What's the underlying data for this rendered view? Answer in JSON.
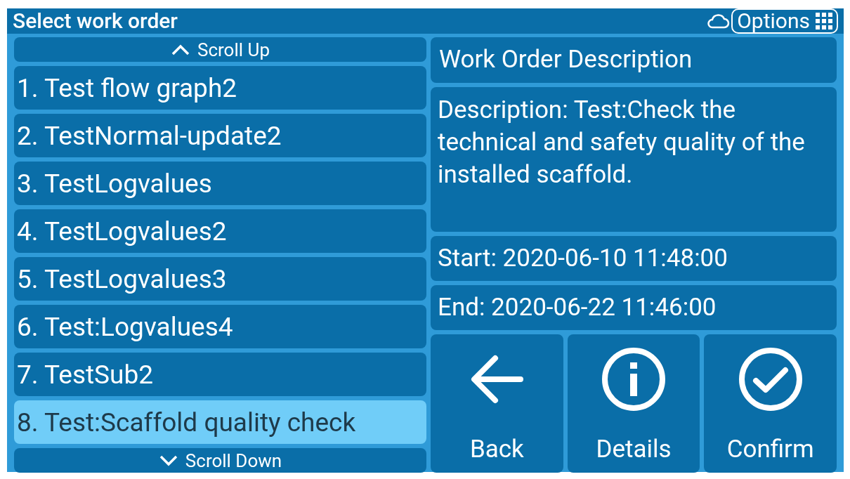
{
  "window": {
    "title": "Select work order",
    "options_button": "Options"
  },
  "list": {
    "scroll_up": "Scroll Up",
    "scroll_down": "Scroll Down",
    "items": [
      {
        "label": "1. Test flow graph2",
        "selected": false
      },
      {
        "label": "2. TestNormal-update2",
        "selected": false
      },
      {
        "label": "3. TestLogvalues",
        "selected": false
      },
      {
        "label": "4. TestLogvalues2",
        "selected": false
      },
      {
        "label": "5. TestLogvalues3",
        "selected": false
      },
      {
        "label": "6. Test:Logvalues4",
        "selected": false
      },
      {
        "label": "7. TestSub2",
        "selected": false
      },
      {
        "label": "8. Test:Scaffold quality check",
        "selected": true
      }
    ]
  },
  "detail": {
    "heading": "Work Order Description",
    "description": "Description: Test:Check the technical and safety quality of the installed scaffold.",
    "start": "Start: 2020-06-10 11:48:00",
    "end": "End: 2020-06-22 11:46:00"
  },
  "actions": [
    {
      "kind": "back",
      "label": "Back"
    },
    {
      "kind": "details",
      "label": "Details"
    },
    {
      "kind": "confirm",
      "label": "Confirm"
    }
  ]
}
